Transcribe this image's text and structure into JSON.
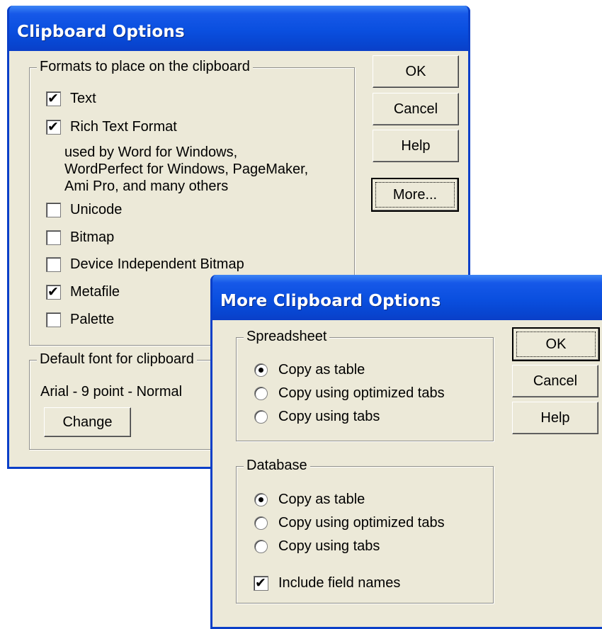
{
  "clipboard_options": {
    "title": "Clipboard Options",
    "formats_group": {
      "legend": "Formats to place on the clipboard",
      "items": [
        {
          "label": "Text",
          "checked": true
        },
        {
          "label": "Rich Text Format",
          "checked": true
        },
        {
          "label": "Unicode",
          "checked": false
        },
        {
          "label": "Bitmap",
          "checked": false
        },
        {
          "label": "Device Independent Bitmap",
          "checked": false
        },
        {
          "label": "Metafile",
          "checked": true
        },
        {
          "label": "Palette",
          "checked": false
        }
      ],
      "rtf_description": [
        "used by Word for Windows,",
        "WordPerfect for Windows, PageMaker,",
        "Ami Pro, and many others"
      ]
    },
    "font_group": {
      "legend": "Default font for clipboard",
      "font_text": "Arial - 9 point - Normal",
      "change_label": "Change"
    },
    "buttons": {
      "ok": "OK",
      "cancel": "Cancel",
      "help": "Help",
      "more": "More..."
    }
  },
  "more_options": {
    "title": "More Clipboard Options",
    "spreadsheet_group": {
      "legend": "Spreadsheet",
      "options": [
        "Copy as table",
        "Copy using optimized tabs",
        "Copy using tabs"
      ],
      "selected": 0
    },
    "database_group": {
      "legend": "Database",
      "options": [
        "Copy as table",
        "Copy using optimized tabs",
        "Copy using tabs"
      ],
      "selected": 0,
      "include_field_names": {
        "label": "Include field names",
        "checked": true
      }
    },
    "buttons": {
      "ok": "OK",
      "cancel": "Cancel",
      "help": "Help"
    }
  },
  "colors": {
    "titlebar": "#0a4fdf",
    "face": "#ece9d8",
    "title_text": "#ffffff"
  },
  "icons": {
    "check": "check-mark-icon",
    "radio": "radio-dot-icon"
  }
}
